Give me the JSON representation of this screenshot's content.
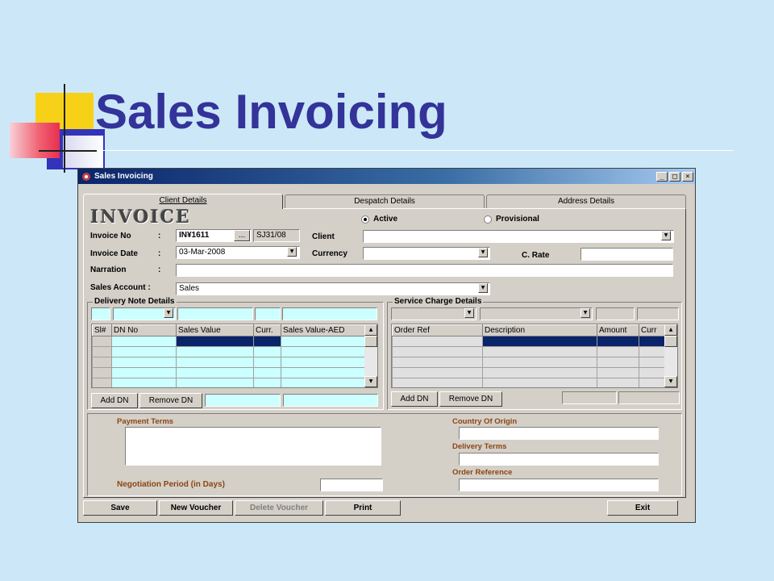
{
  "slide": {
    "title": "Sales Invoicing"
  },
  "window": {
    "title": "Sales Invoicing",
    "controls": {
      "minimize": "_",
      "maximize": "□",
      "close": "×"
    }
  },
  "tabs": [
    {
      "label": "Client Details",
      "active": true
    },
    {
      "label": "Despatch Details",
      "active": false
    },
    {
      "label": "Address Details",
      "active": false
    }
  ],
  "header": {
    "logo_text": "INVOICE",
    "status_active": "Active",
    "status_provisional": "Provisional",
    "selected_status": "Active"
  },
  "form": {
    "invoice_no_label": "Invoice No",
    "invoice_no_value": "IN¥1611",
    "invoice_no_browse": "...",
    "invoice_ref": "SJ31/08",
    "invoice_date_label": "Invoice Date",
    "invoice_date_value": "03-Mar-2008",
    "narration_label": "Narration",
    "narration_value": "",
    "sales_account_label": "Sales Account :",
    "sales_account_value": "Sales",
    "client_label": "Client",
    "client_value": "",
    "currency_label": "Currency",
    "currency_value": "",
    "c_rate_label": "C. Rate",
    "c_rate_value": "",
    "colon": ":"
  },
  "delivery": {
    "title": "Delivery Note Details",
    "columns": [
      "Sl#",
      "DN No",
      "Sales Value",
      "Curr.",
      "Sales Value-AED"
    ],
    "row_count": 5,
    "add_button": "Add DN",
    "remove_button": "Remove DN"
  },
  "service": {
    "title": "Service Charge Details",
    "columns": [
      "Order Ref",
      "Description",
      "Amount",
      "Curr"
    ],
    "row_count": 5,
    "add_button": "Add DN",
    "remove_button": "Remove DN"
  },
  "bottom": {
    "payment_terms_label": "Payment Terms",
    "negotiation_label": "Negotiation Period (in Days)",
    "country_label": "Country Of Origin",
    "delivery_terms_label": "Delivery Terms",
    "order_reference_label": "Order Reference"
  },
  "actions": {
    "save": "Save",
    "new_voucher": "New Voucher",
    "delete_voucher": "Delete Voucher",
    "print": "Print",
    "exit": "Exit"
  },
  "colors": {
    "title": "#333399",
    "window_bg": "#d4d0c8",
    "grid_bg": "#ccffff",
    "selection": "#0a246a",
    "label_brown": "#8b4513"
  }
}
